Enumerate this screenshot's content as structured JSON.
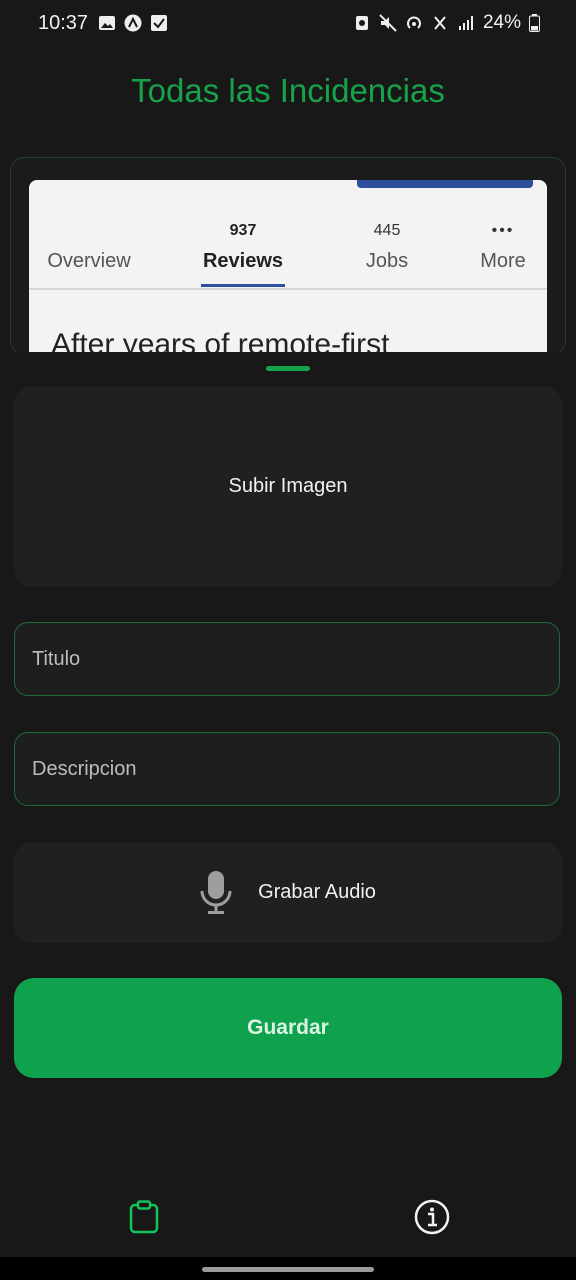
{
  "status_bar": {
    "time": "10:37",
    "battery": "24%",
    "left_icons": [
      "image-icon",
      "app-a-icon",
      "checkbox-icon"
    ],
    "right_icons": [
      "nfc-icon",
      "mute-icon",
      "hotspot-icon",
      "signal-activity-icon",
      "signal-bars-icon",
      "battery-icon"
    ]
  },
  "page": {
    "title": "Todas las Incidencias"
  },
  "preview": {
    "tabs": [
      {
        "count": "",
        "label": "Overview"
      },
      {
        "count": "937",
        "label": "Reviews"
      },
      {
        "count": "445",
        "label": "Jobs"
      },
      {
        "count": "•••",
        "label": "More"
      }
    ],
    "headline": "After years of remote-first"
  },
  "form": {
    "upload_label": "Subir Imagen",
    "title_placeholder": "Titulo",
    "description_placeholder": "Descripcion",
    "audio_label": "Grabar Audio",
    "save_label": "Guardar"
  },
  "bottom_nav": {
    "items": [
      {
        "icon": "clipboard-icon",
        "active": true
      },
      {
        "icon": "info-icon",
        "active": false
      }
    ]
  },
  "colors": {
    "accent": "#16a34a",
    "button": "#0fa14e",
    "background": "#181818"
  }
}
